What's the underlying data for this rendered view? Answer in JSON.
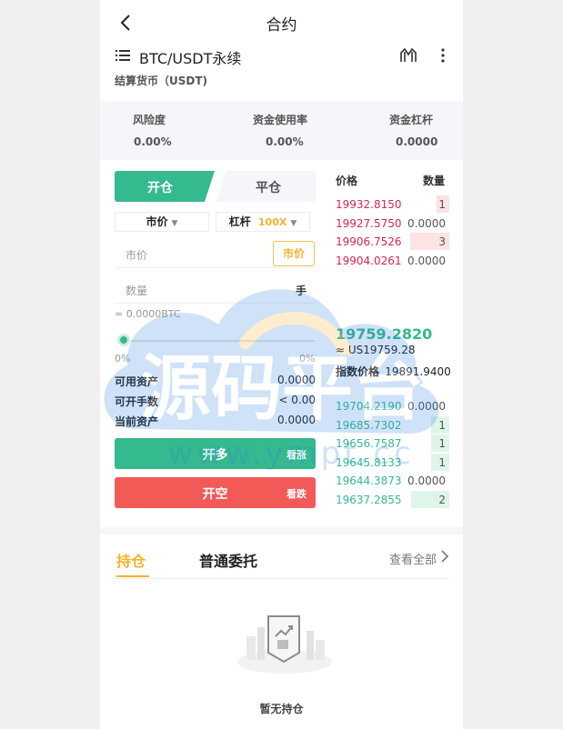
{
  "header": {
    "title": "合约"
  },
  "pair": {
    "name": "BTC/USDT永续",
    "settle": "结算货币（USDT)"
  },
  "stats": [
    {
      "label": "风险度",
      "value": "0.00%"
    },
    {
      "label": "资金使用率",
      "value": "0.00%"
    },
    {
      "label": "资金杠杆",
      "value": "0.0000"
    }
  ],
  "trade": {
    "tab_open": "开仓",
    "tab_close": "平仓",
    "order_type": "市价",
    "leverage_label": "杠杆",
    "leverage_value": "100X",
    "price_placeholder": "市价",
    "price_button": "市价",
    "qty_placeholder": "数量",
    "qty_unit": "手",
    "equiv": "= 0.0000BTC",
    "slider_min_label": "0%",
    "slider_max_label": "0%",
    "slider_value": 0,
    "account": [
      {
        "label": "可用资产",
        "value": "0.0000"
      },
      {
        "label": "可开手数",
        "value": "< 0.00"
      },
      {
        "label": "当前资产",
        "value": "0.0000"
      }
    ],
    "long_button": "开多",
    "long_hint": "看涨",
    "short_button": "开空",
    "short_hint": "看跌"
  },
  "orderbook": {
    "price_header": "价格",
    "qty_header": "数量",
    "asks": [
      {
        "price": "19932.8150",
        "qty": "1",
        "depth": 0.24
      },
      {
        "price": "19927.5750",
        "qty": "0.0000",
        "depth": 0
      },
      {
        "price": "19906.7526",
        "qty": "3",
        "depth": 0.72
      },
      {
        "price": "19904.0261",
        "qty": "0.0000",
        "depth": 0
      }
    ],
    "last_price": "19759.2820",
    "last_usd": "≈ US19759.28",
    "index_label": "指数价格",
    "index_value": "19891.9400",
    "bids": [
      {
        "price": "19704.2190",
        "qty": "0.0000",
        "depth": 0
      },
      {
        "price": "19685.7302",
        "qty": "1",
        "depth": 0.34
      },
      {
        "price": "19656.7587",
        "qty": "1",
        "depth": 0.34
      },
      {
        "price": "19645.8133",
        "qty": "1",
        "depth": 0.34
      },
      {
        "price": "19644.3873",
        "qty": "0.0000",
        "depth": 0
      },
      {
        "price": "19637.2855",
        "qty": "2",
        "depth": 0.7
      }
    ]
  },
  "positions": {
    "tab_hold": "持仓",
    "tab_entrust": "普通委托",
    "view_all": "查看全部",
    "empty": "暂无持仓"
  },
  "watermark": {
    "text": "源码平台",
    "url": "www.ympt.cc"
  },
  "colors": {
    "green": "#35b98e",
    "red": "#f25a58",
    "accent": "#f3b22a"
  }
}
